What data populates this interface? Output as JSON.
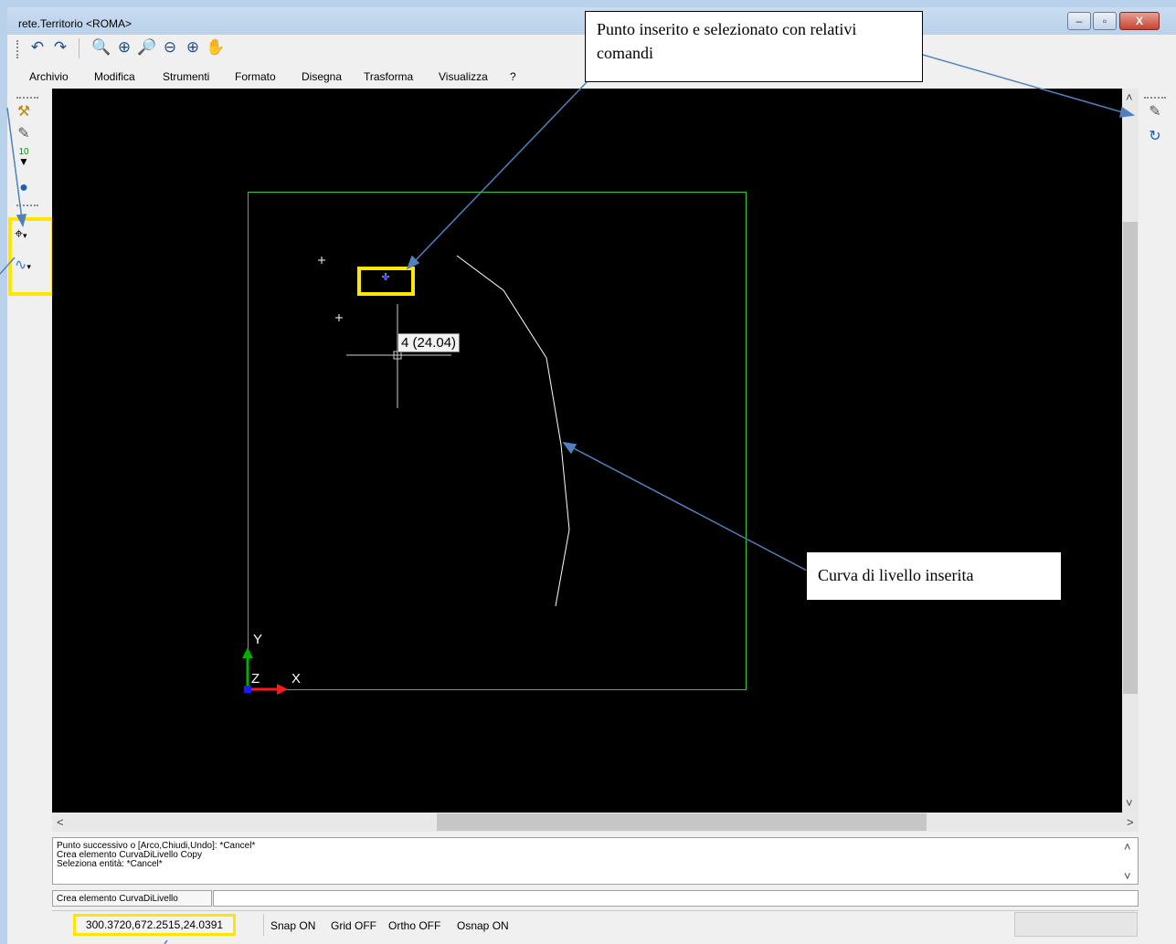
{
  "window": {
    "title": "rete.Territorio <ROMA>",
    "controls": [
      "–",
      "▫",
      "X"
    ]
  },
  "toolbar": {
    "icons": [
      "undo-icon",
      "redo-icon",
      "zoom-extents-icon",
      "zoom-window-icon",
      "zoom-realtime-icon",
      "zoom-out-icon",
      "zoom-in-icon",
      "pan-icon"
    ]
  },
  "menu": {
    "items": [
      "Archivio",
      "Modifica",
      "Strumenti",
      "Formato",
      "Disegna",
      "Trasforma",
      "Visualizza",
      "?"
    ]
  },
  "canvas": {
    "point_label": "4 (24.04)",
    "axis_x": "X",
    "axis_y": "Y",
    "axis_z": "Z",
    "colors": {
      "frame": "#2ecc2e",
      "curve": "#ffffff",
      "background": "#000000"
    }
  },
  "command_log": {
    "lines": [
      "Punto successivo o [Arco,Chiudi,Undo]: *Cancel*",
      "Crea elemento CurvaDiLivello Copy",
      "Seleziona entità: *Cancel*"
    ],
    "prompt_label": "Crea elemento CurvaDiLivello",
    "input_value": ""
  },
  "status": {
    "coords": "300.3720,672.2515,24.0391",
    "snap": "Snap ON",
    "grid": "Grid OFF",
    "ortho": "Ortho OFF",
    "osnap": "Osnap ON"
  },
  "annotations": {
    "callout_point": "Punto inserito e selezionato con relativi comandi",
    "callout_curve": "Curva di livello inserita",
    "highlight_color": "#ffe600",
    "arrow_color": "#4f81bd"
  }
}
